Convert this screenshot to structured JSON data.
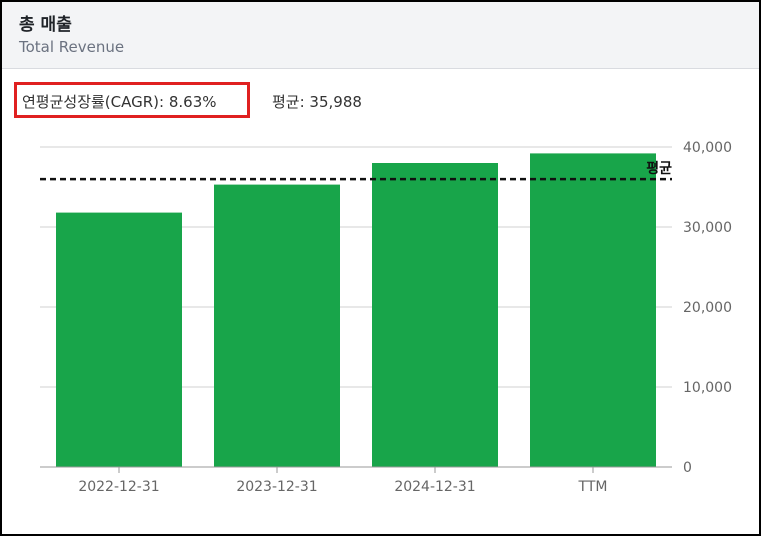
{
  "header": {
    "title": "총 매출",
    "subtitle": "Total Revenue"
  },
  "stats": {
    "cagr_label": "연평균성장률(CAGR): 8.63%",
    "average_label": "평균: 35,988"
  },
  "colors": {
    "bar": "#18a54a",
    "grid": "#d0d0d0",
    "highlight_border": "#e02020",
    "average_line": "#111111"
  },
  "chart_data": {
    "type": "bar",
    "categories": [
      "2022-12-31",
      "2023-12-31",
      "2024-12-31",
      "TTM"
    ],
    "values": [
      31800,
      35300,
      38000,
      39200
    ],
    "average": 35988,
    "average_label": "평균",
    "ylim": [
      0,
      40000
    ],
    "y_ticks": [
      0,
      10000,
      20000,
      30000,
      40000
    ],
    "y_tick_labels": [
      "0",
      "10,000",
      "20,000",
      "30,000",
      "40,000"
    ],
    "y_axis_side": "right",
    "grid": true
  }
}
